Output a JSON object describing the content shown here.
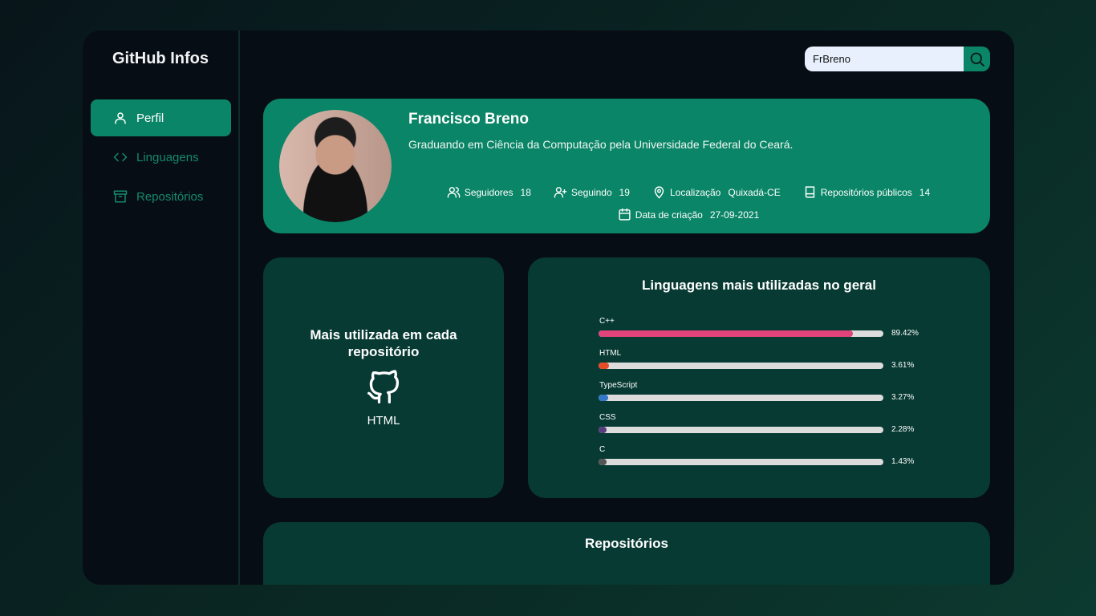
{
  "brand": "GitHub Infos",
  "nav": [
    {
      "label": "Perfil",
      "icon": "user-icon",
      "active": true
    },
    {
      "label": "Linguagens",
      "icon": "code-icon",
      "active": false
    },
    {
      "label": "Repositórios",
      "icon": "archive-icon",
      "active": false
    }
  ],
  "search": {
    "value": "FrBreno",
    "icon": "search-icon"
  },
  "profile": {
    "name": "Francisco Breno",
    "bio": "Graduando em Ciência da Computação pela Universidade Federal do Ceará.",
    "stats": {
      "followers_label": "Seguidores",
      "followers": "18",
      "following_label": "Seguindo",
      "following": "19",
      "location_label": "Localização",
      "location": "Quixadá-CE",
      "repos_label": "Repositórios públicos",
      "repos": "14",
      "created_label": "Data de criação",
      "created": "27-09-2021"
    }
  },
  "most_used": {
    "title": "Mais utilizada em cada repositório",
    "language": "HTML",
    "icon": "github-icon"
  },
  "languages": {
    "title": "Linguagens mais utilizadas no geral",
    "items": [
      {
        "name": "C++",
        "percent_label": "89.42%",
        "percent": 89.42,
        "color": "#e0447a"
      },
      {
        "name": "HTML",
        "percent_label": "3.61%",
        "percent": 3.61,
        "color": "#e34c26"
      },
      {
        "name": "TypeScript",
        "percent_label": "3.27%",
        "percent": 3.27,
        "color": "#3178c6"
      },
      {
        "name": "CSS",
        "percent_label": "2.28%",
        "percent": 2.28,
        "color": "#563d7c"
      },
      {
        "name": "C",
        "percent_label": "1.43%",
        "percent": 1.43,
        "color": "#555555"
      }
    ]
  },
  "repositories": {
    "title": "Repositórios"
  },
  "colors": {
    "accent": "#0b8567",
    "card": "#073a33",
    "panel": "#070d14"
  }
}
